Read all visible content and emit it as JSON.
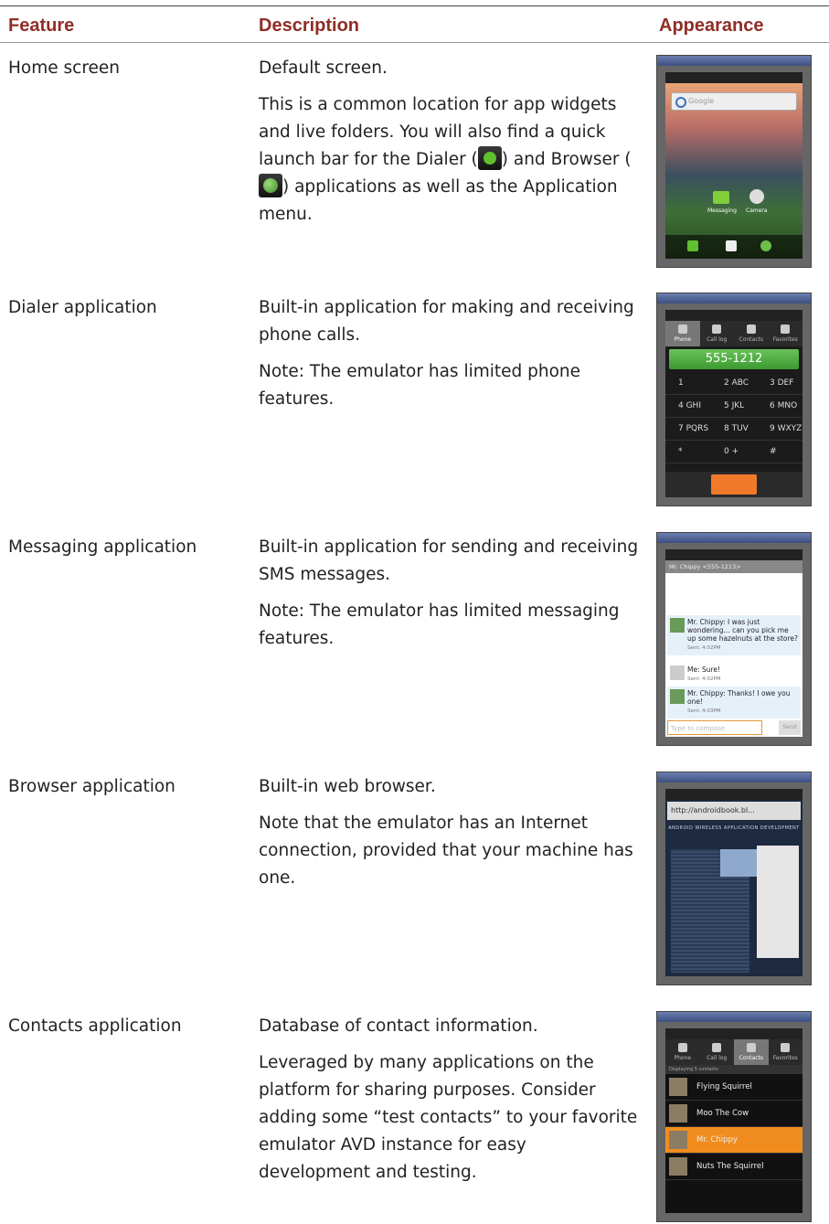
{
  "header": {
    "feature": "Feature",
    "description": "Description",
    "appearance": "Appearance"
  },
  "rows": [
    {
      "feature": "Home screen",
      "desc1": "Default screen.",
      "desc2a": "This is a common location for app widgets and live folders. You will also find a quick launch bar for the Dialer (",
      "desc2b": ") and Browser (",
      "desc2c": ") applications as well as the Application menu.",
      "screenshot": {
        "search_placeholder": "Google",
        "widget1": "Messaging",
        "widget2": "Camera"
      }
    },
    {
      "feature": "Dialer application",
      "desc1": "Built-in application for making and receiving phone calls.",
      "desc2": "Note: The emulator has limited phone features.",
      "screenshot": {
        "tabs": [
          "Phone",
          "Call log",
          "Contacts",
          "Favorites"
        ],
        "number": "555-1212",
        "keys": [
          "1",
          "2 ABC",
          "3 DEF",
          "4 GHI",
          "5 JKL",
          "6 MNO",
          "7 PQRS",
          "8 TUV",
          "9 WXYZ",
          "*",
          "0 +",
          "#"
        ]
      }
    },
    {
      "feature": "Messaging application",
      "desc1": "Built-in application for sending and receiving SMS messages.",
      "desc2": "Note: The emulator has limited messaging features.",
      "screenshot": {
        "title": "Mr. Chippy <555-1213>",
        "m1": "Mr. Chippy: I was just wondering... can you pick me up some hazelnuts at the store?",
        "m1_time": "Sent: 4:02PM",
        "m2": "Me: Sure!",
        "m2_time": "Sent: 4:02PM",
        "m3": "Mr. Chippy: Thanks! I owe you one!",
        "m3_time": "Sent: 4:03PM",
        "compose": "Type to compose",
        "send": "Send"
      }
    },
    {
      "feature": "Browser application",
      "desc1": "Built-in web browser.",
      "desc2": "Note that the emulator has an Internet connection, provided that your machine has one.",
      "screenshot": {
        "url": "http://androidbook.bl...",
        "blog_title": "ANDROID WIRELESS APPLICATION DEVELOPMENT"
      }
    },
    {
      "feature": "Contacts application",
      "desc1": "Database of contact information.",
      "desc2": "Leveraged by many applications on the platform for sharing purposes. Consider adding some “test contacts” to your favorite emulator AVD instance for easy development and testing.",
      "screenshot": {
        "tabs": [
          "Phone",
          "Call log",
          "Contacts",
          "Favorites"
        ],
        "displaying": "Displaying 5 contacts",
        "contacts": [
          "Flying Squirrel",
          "Moo The Cow",
          "Mr. Chippy",
          "Nuts The Squirrel"
        ]
      }
    }
  ]
}
